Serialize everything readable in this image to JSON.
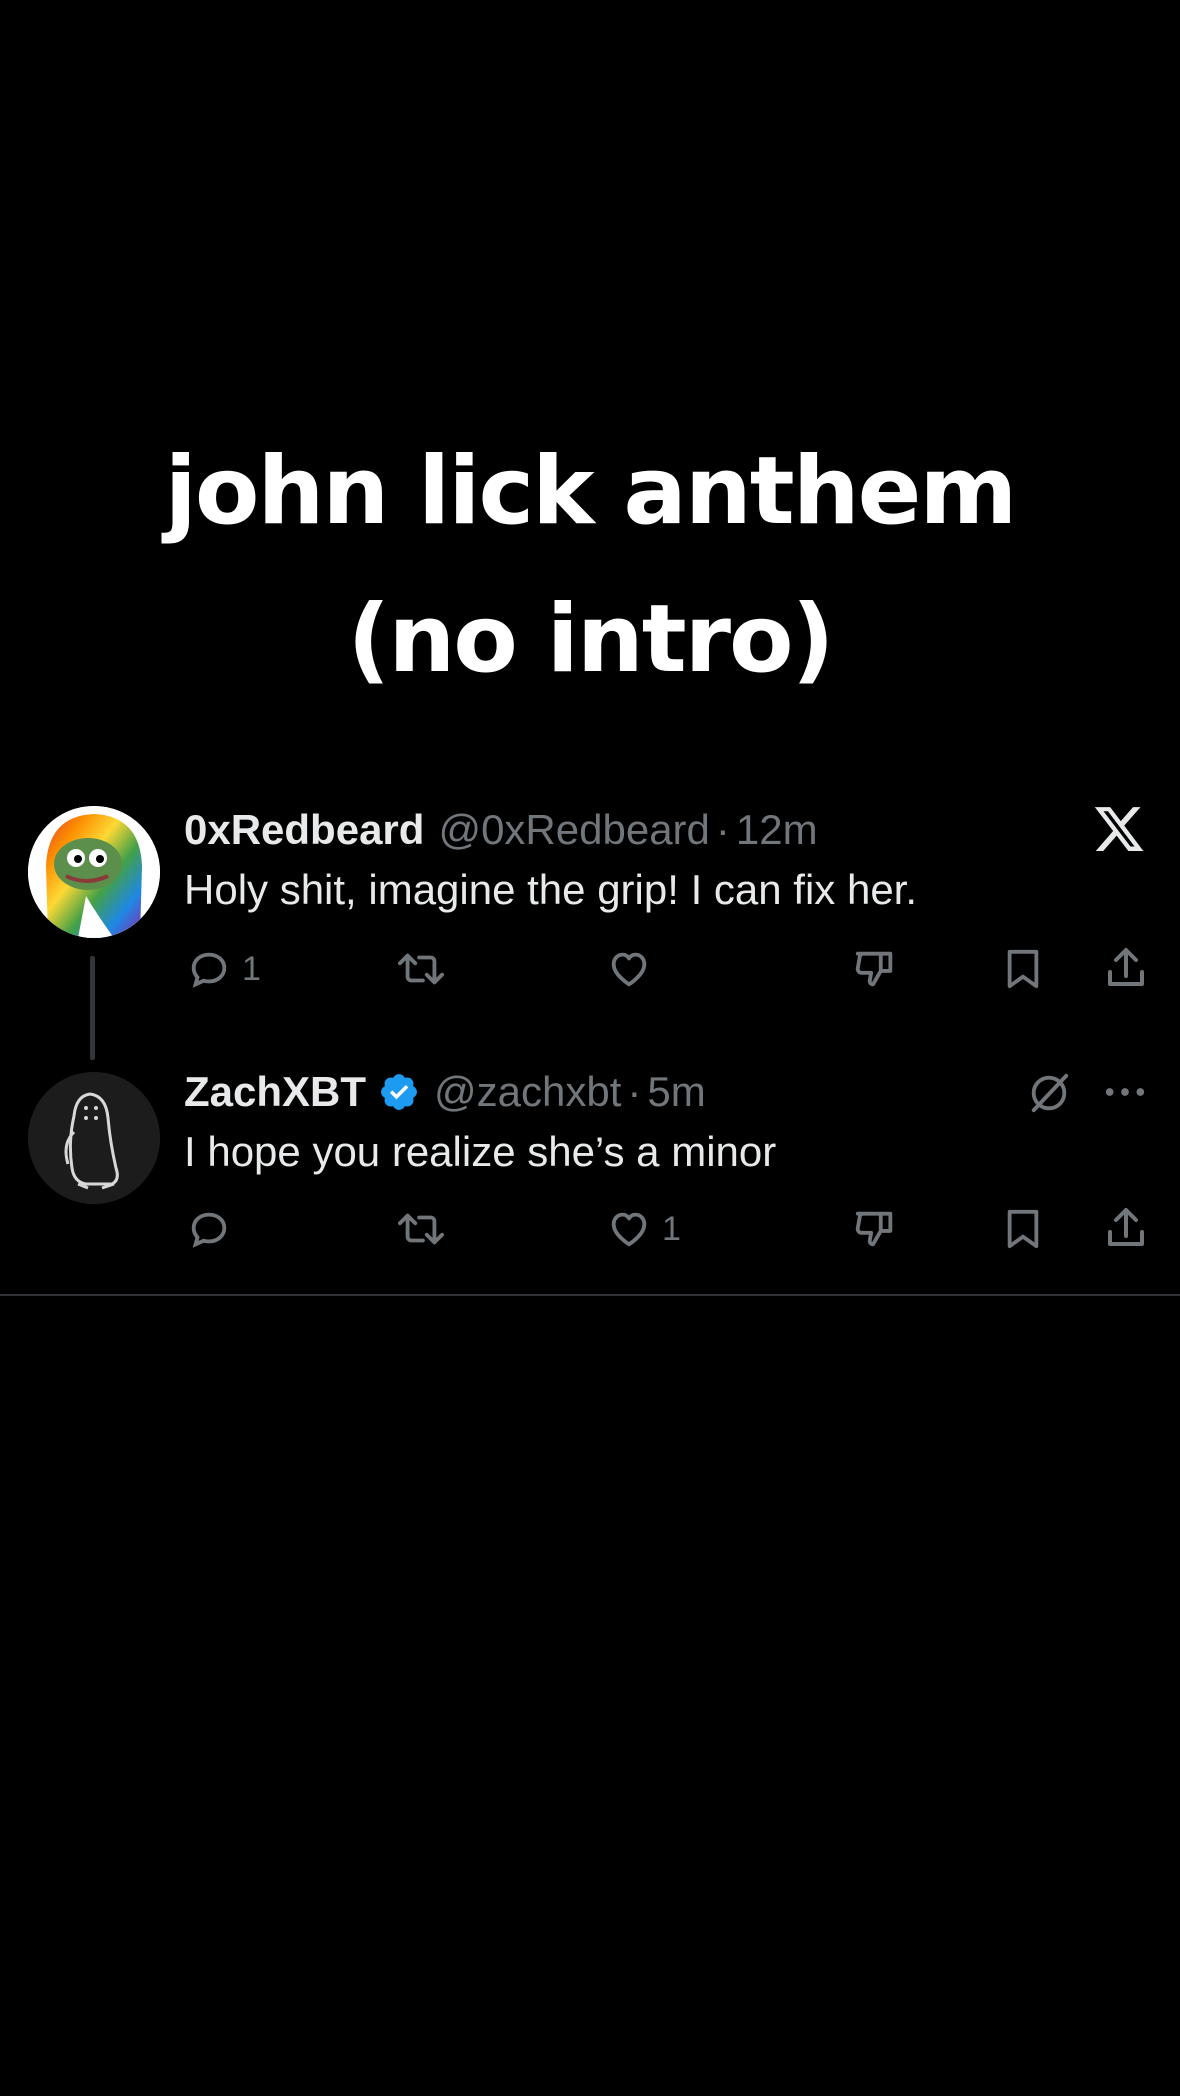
{
  "caption": {
    "line1": "john lick anthem",
    "line2": "(no intro)"
  },
  "tweets": [
    {
      "name": "0xRedbeard",
      "handle": "@0xRedbeard",
      "separator": "·",
      "time": "12m",
      "text": "Holy shit, imagine the grip! I can fix her.",
      "reply_count": "1",
      "like_count": "",
      "avatar_icon": "frog-in-rainbow-hoodie-avatar",
      "verified": false
    },
    {
      "name": "ZachXBT",
      "handle": "@zachxbt",
      "separator": "·",
      "time": "5m",
      "text": "I hope you realize she’s a minor",
      "reply_count": "",
      "like_count": "1",
      "avatar_icon": "penguin-sketch-avatar",
      "verified": true
    }
  ],
  "colors": {
    "background": "#000000",
    "primary_text": "#e7e9ea",
    "secondary_text": "#71767b",
    "verified_blue": "#1d9bf0",
    "divider": "#2f3336"
  }
}
